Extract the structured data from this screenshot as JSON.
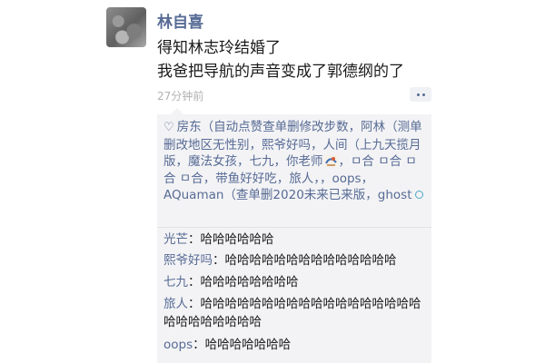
{
  "post": {
    "username": "林自喜",
    "lines": [
      "得知林志玲结婚了",
      "我爸把导航的声音变成了郭德纲的了"
    ],
    "time": "27分钟前"
  },
  "likes": {
    "icon": "heart-outline-icon",
    "text_part1": "房东（自动点赞查单删修改步数，阿林（测单删改地区无性别，熙爷好吗，人间（上九天揽月版，魔法女孩，七九，你老师",
    "text_part2": "，ㅁ合 ㅁ合   ㅁ合   ㅁ合，带鱼好好吃，旅人，，oops，AQuaman（查单删2020未来已来版，ghost"
  },
  "comments": [
    {
      "name": "光芒",
      "sep": "：",
      "text": "哈哈哈哈哈哈"
    },
    {
      "name": "熙爷好吗",
      "sep": "：",
      "text": "哈哈哈哈哈哈哈哈哈哈哈哈哈哈"
    },
    {
      "name": "七九",
      "sep": "：",
      "text": "哈哈哈哈哈哈哈哈"
    },
    {
      "name": "旅人",
      "sep": "：",
      "text": "哈哈哈哈哈哈哈哈哈哈哈哈哈哈哈哈哈哈哈哈哈哈哈哈哈哈"
    },
    {
      "name": "oops",
      "sep": "：",
      "text": "哈哈哈哈哈哈哈"
    }
  ],
  "colors": {
    "link": "#576b95",
    "panel_bg": "#f3f3f5",
    "time": "#b2b2b2"
  }
}
